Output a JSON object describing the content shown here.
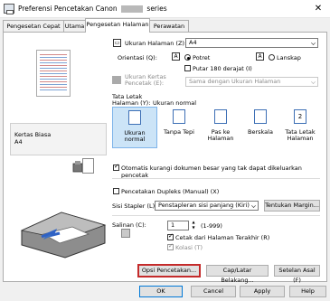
{
  "window": {
    "title_pre": "Preferensi Pencetakan Canon",
    "title_post": "series"
  },
  "tabs": [
    "Pengesetan Cepat",
    "Utama",
    "Pengesetan Halaman",
    "Perawatan"
  ],
  "left": {
    "paper_name": "Kertas Biasa",
    "paper_size": "A4"
  },
  "page_size": {
    "label": "Ukuran Halaman (Z):",
    "value": "A4"
  },
  "orientation": {
    "label": "Orientasi (Q):",
    "portrait": "Potret",
    "landscape": "Lanskap",
    "rotate": "Putar 180 derajat (I)"
  },
  "output_size": {
    "label1": "Ukuran Kertas",
    "label2": "Pencetak (E):",
    "value": "Sama dengan Ukuran Halaman"
  },
  "layout": {
    "label1": "Tata Letak",
    "label2": "Halaman (Y):",
    "current": "Ukuran normal",
    "options": [
      {
        "l1": "Ukuran normal",
        "l2": ""
      },
      {
        "l1": "Tanpa Tepi",
        "l2": ""
      },
      {
        "l1": "Pas ke",
        "l2": "Halaman"
      },
      {
        "l1": "Berskala",
        "l2": ""
      },
      {
        "l1": "Tata Letak",
        "l2": "Halaman"
      }
    ]
  },
  "auto_reduce": "Otomatis kurangi dokumen besar yang tak dapat dikeluarkan pencetak",
  "duplex": "Pencetakan Dupleks (Manual) (X)",
  "stapling": {
    "label": "Sisi Stapler (L):",
    "value": "Penstapleran sisi panjang (Kiri)",
    "button": "Tentukan Margin..."
  },
  "copies": {
    "label": "Salinan (C):",
    "value": "1",
    "range": "(1-999)",
    "last_first": "Cetak dari Halaman Terakhir (R)",
    "collate": "Kolasi (T)"
  },
  "buttons": {
    "options": "Opsi Pencetakan...",
    "stamp": "Cap/Latar Belakang...",
    "defaults": "Setelan Asal (F)"
  },
  "footer": {
    "ok": "OK",
    "cancel": "Cancel",
    "apply": "Apply",
    "help": "Help"
  }
}
